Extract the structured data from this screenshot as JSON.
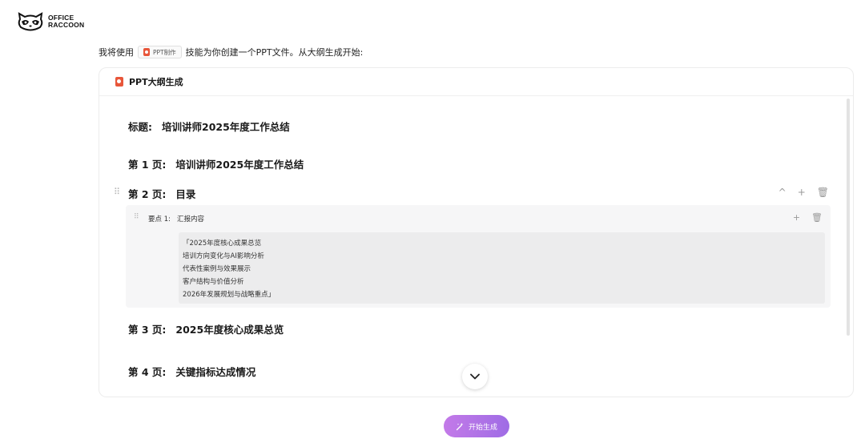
{
  "logo": {
    "line1": "OFFICE",
    "line2": "RACCOON"
  },
  "intro": {
    "prefix": "我将使用",
    "skill_label": "PPT制作",
    "suffix": "技能为你创建一个PPT文件。从大纲生成开始:"
  },
  "card": {
    "title": "PPT大纲生成",
    "title_row": {
      "label": "标题:",
      "value": "培训讲师2025年度工作总结"
    },
    "pages": [
      {
        "label": "第 1 页:",
        "value": "培训讲师2025年度工作总结"
      },
      {
        "label": "第 2 页:",
        "value": "目录"
      },
      {
        "label": "第 3 页:",
        "value": "2025年度核心成果总览"
      },
      {
        "label": "第 4 页:",
        "value": "关键指标达成情况"
      }
    ],
    "point": {
      "label": "要点 1:",
      "value": "汇报内容",
      "lines": [
        "「2025年度核心成果总览",
        "培训方向变化与AI影响分析",
        "代表性案例与效果展示",
        "客户结构与价值分析",
        "2026年发展规划与战略重点」"
      ]
    },
    "actions": {
      "up": "^",
      "add": "+",
      "delete": "🗑"
    }
  },
  "generate_button": {
    "label": "开始生成"
  }
}
